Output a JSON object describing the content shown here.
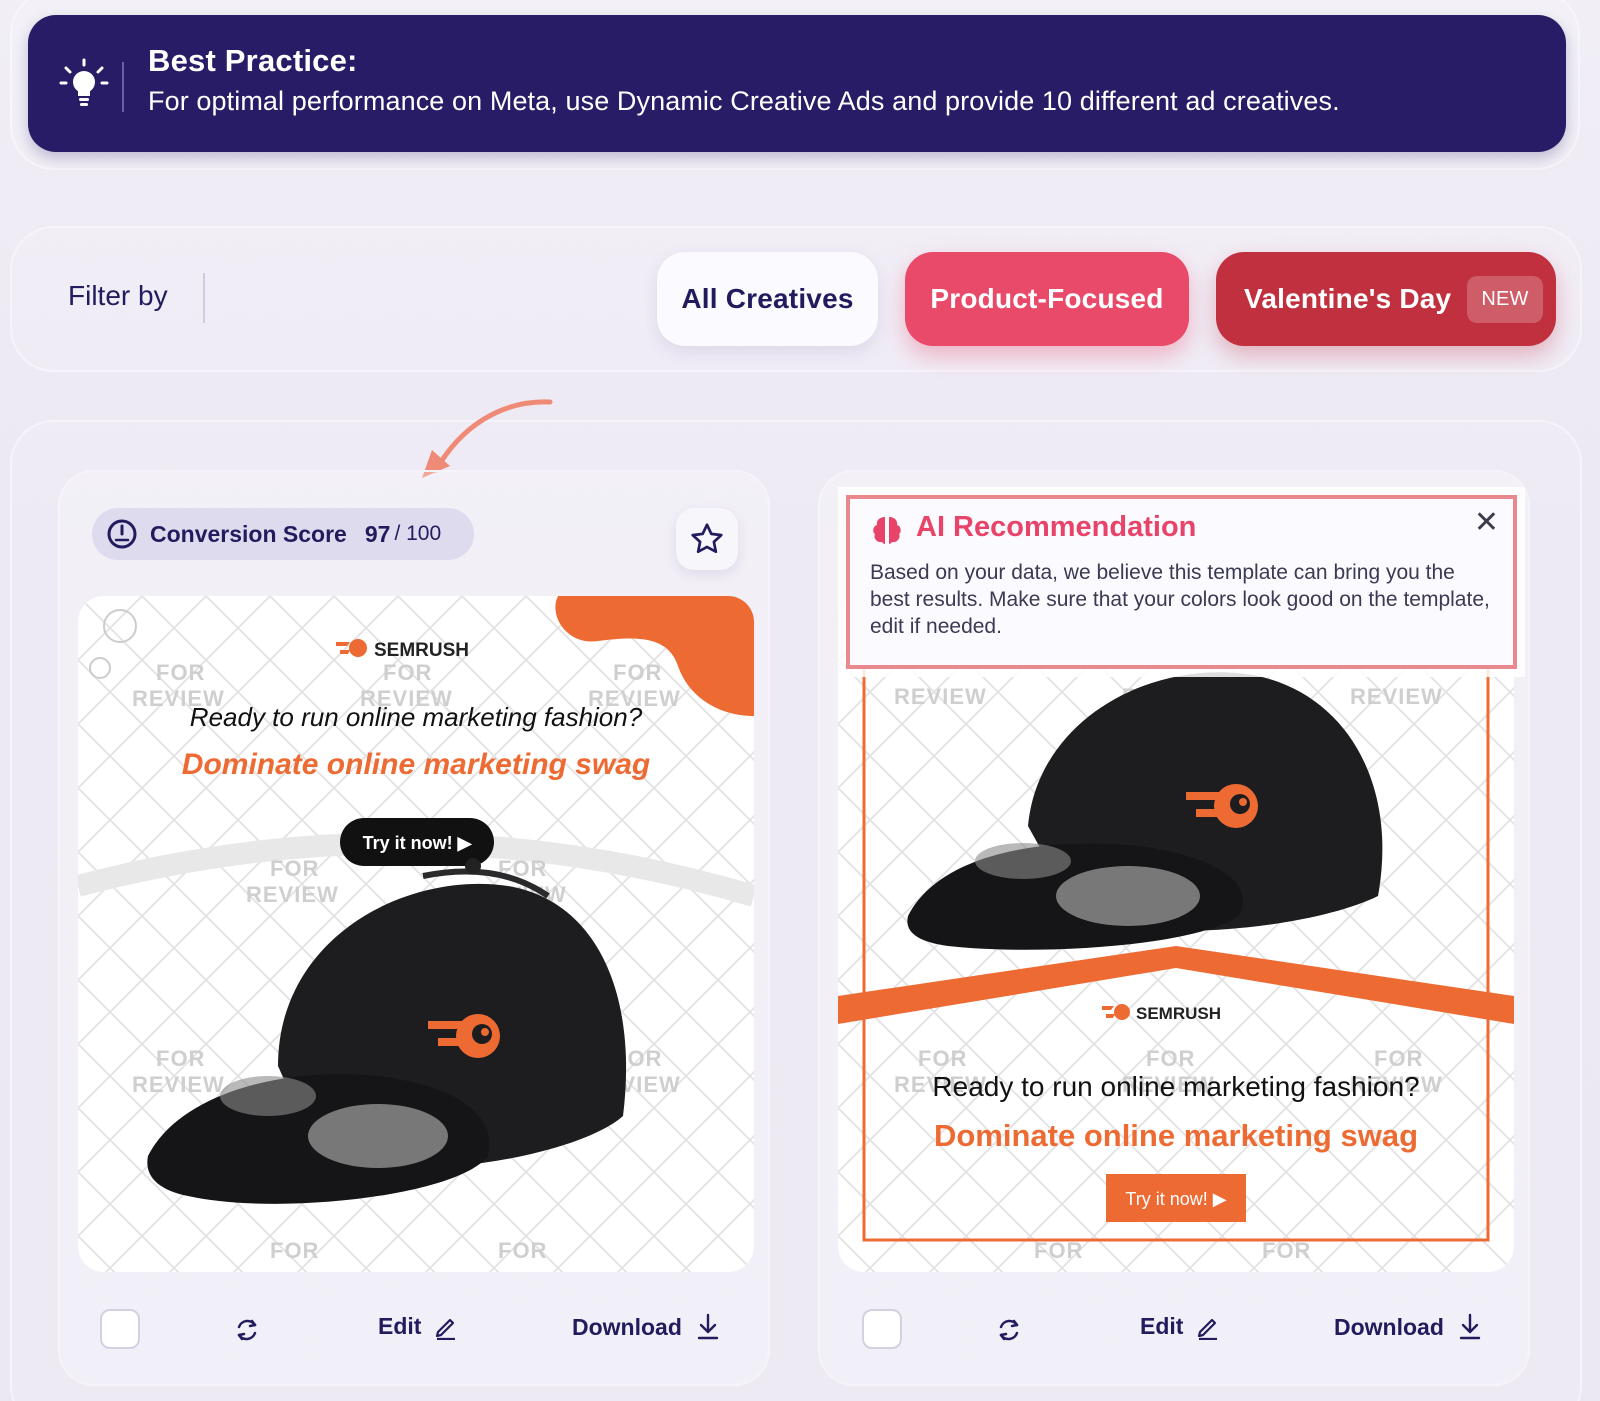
{
  "banner": {
    "title": "Best Practice:",
    "text": "For optimal performance on Meta, use Dynamic Creative Ads and provide 10 different ad creatives.",
    "icon": "lightbulb-icon"
  },
  "filter": {
    "label": "Filter by",
    "options": [
      {
        "label": "All Creatives",
        "state": "default"
      },
      {
        "label": "Product-Focused",
        "state": "selected"
      },
      {
        "label": "Valentine's Day",
        "badge": "NEW",
        "state": "default"
      }
    ]
  },
  "cards": [
    {
      "score_label": "Conversion Score",
      "score_value": "97",
      "score_max": "/ 100",
      "ad": {
        "brand": "SEMRUSH",
        "headline": "Ready to run online marketing fashion?",
        "subheadline": "Dominate online marketing swag",
        "cta": "Try it now! ▶",
        "watermark_top": "FOR",
        "watermark_bottom": "REVIEW"
      },
      "actions": {
        "edit": "Edit",
        "download": "Download"
      }
    },
    {
      "recommendation": {
        "title": "AI Recommendation",
        "text": "Based on your data, we believe this template can bring you the best results. Make sure that your colors look good on the template, edit if needed.",
        "close": "✕"
      },
      "ad": {
        "brand": "SEMRUSH",
        "headline": "Ready to run online marketing fashion?",
        "subheadline": "Dominate online marketing swag",
        "cta": "Try it now! ▶",
        "watermark_top": "FOR",
        "watermark_bottom": "REVIEW"
      },
      "actions": {
        "edit": "Edit",
        "download": "Download"
      }
    }
  ],
  "colors": {
    "banner_bg": "#281c66",
    "accent_pink": "#ea4a6a",
    "accent_red": "#c0303e",
    "semrush_orange": "#ee6a33",
    "ai_border": "#e9898d"
  }
}
